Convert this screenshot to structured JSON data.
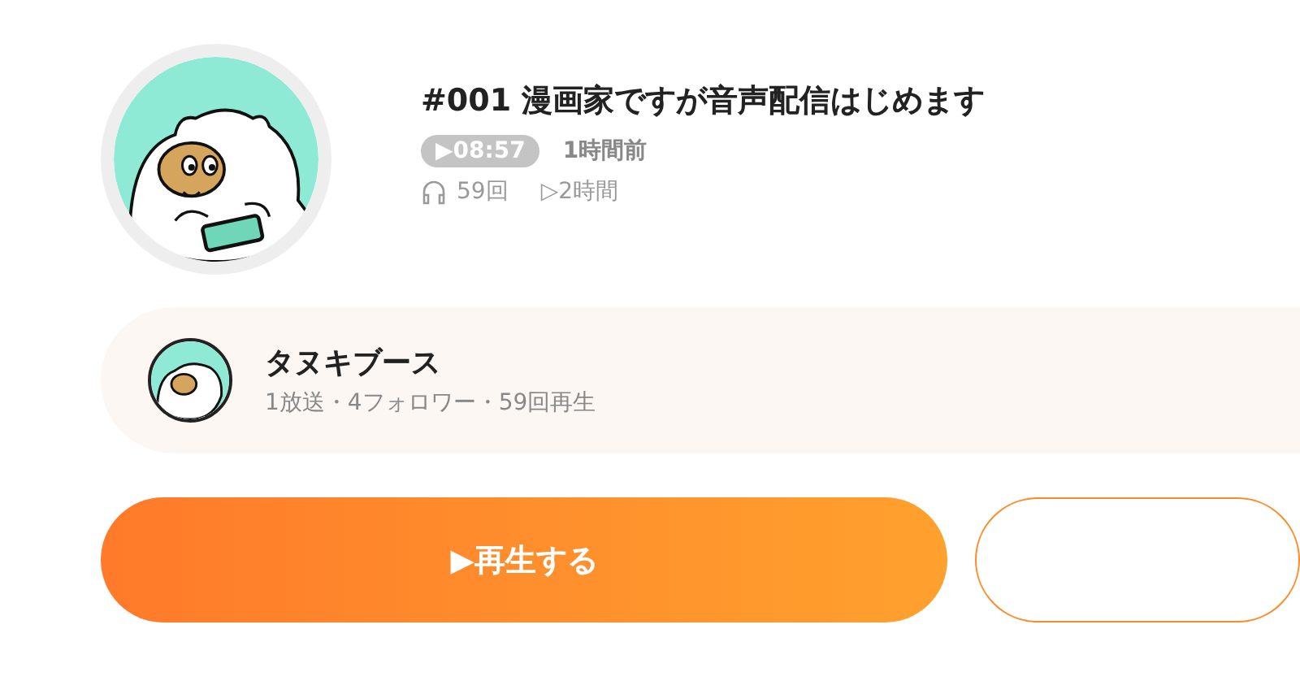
{
  "episode": {
    "title": "#001 漫画家ですが音声配信はじめます",
    "duration": "▶08:57",
    "posted": "1時間前",
    "plays": "59回",
    "total_time": "▷2時間"
  },
  "channel": {
    "name": "タヌキブース",
    "stats": "1放送・4フォロワー・59回再生"
  },
  "play_button": {
    "label": "▶再生する"
  }
}
